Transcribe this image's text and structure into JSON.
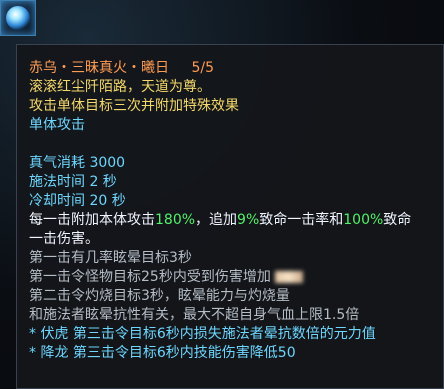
{
  "tooltip": {
    "title": "赤乌・三昧真火・曦日",
    "level": "5/5",
    "flavor_line": "滚滚红尘阡陌路，天道为尊。",
    "effect_line": "攻击单体目标三次并附加特殊效果",
    "target_type": "单体攻击",
    "mp_cost": "真气消耗 3000",
    "cast_time": "施法时间 2 秒",
    "cooldown": "冷却时间 20 秒",
    "hit_1_part_a": "每一击附加本体攻击",
    "hit_1_value_a": "180%",
    "hit_1_part_b": "，追加",
    "hit_1_value_b": "9%",
    "hit_1_part_c": "致命一击率和",
    "hit_1_value_c": "100%",
    "hit_1_part_d": "致命",
    "hit_1_line2": "一击伤害。",
    "line_first": "第一击有几率眩晕目标3秒",
    "line_second_a": "第一击令怪物目标25秒内受到伤害增加",
    "line_third_a": "第二击令灼烧目标3秒，眩晕能力与灼烧量",
    "line_third_b": "和施法者眩晕抗性有关，最大不超自身气血上限1.5倍",
    "talent_1": "* 伏虎  第三击令目标6秒内损失施法者晕抗数倍的元力值",
    "talent_2": "* 降龙  第三击令目标6秒内技能伤害降低50"
  }
}
